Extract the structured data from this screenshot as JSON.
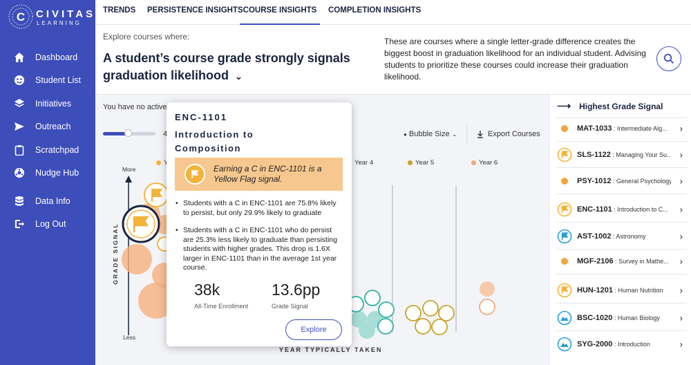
{
  "brand": {
    "line1": "CIVITAS",
    "line2": "LEARNING",
    "letter": "C"
  },
  "sidebar": {
    "items": [
      {
        "label": "Dashboard",
        "icon": "home-icon"
      },
      {
        "label": "Student List",
        "icon": "student-icon"
      },
      {
        "label": "Initiatives",
        "icon": "layers-icon"
      },
      {
        "label": "Outreach",
        "icon": "send-icon"
      },
      {
        "label": "Scratchpad",
        "icon": "clipboard-icon"
      },
      {
        "label": "Nudge Hub",
        "icon": "nudge-icon"
      },
      {
        "label": "Data Info",
        "icon": "database-icon"
      },
      {
        "label": "Log Out",
        "icon": "logout-icon"
      }
    ]
  },
  "tabs": [
    {
      "label": "TRENDS"
    },
    {
      "label": "PERSISTENCE INSIGHTS"
    },
    {
      "label": "COURSE INSIGHTS",
      "active": true
    },
    {
      "label": "COMPLETION INSIGHTS"
    }
  ],
  "header": {
    "explore_label": "Explore courses where:",
    "headline": "A student’s course grade strongly signals graduation likelihood",
    "description": "These are courses where a single letter-grade difference creates the biggest boost in graduation likelihood for an individual student. Advising students to prioritize these courses could increase their graduation likelihood."
  },
  "main": {
    "no_active": "You have no active",
    "slider_value": "4",
    "bubble_size": "Bubble Size",
    "export": "Export Courses"
  },
  "chart": {
    "y_more": "More",
    "y_less": "Less",
    "y_label": "GRADE SIGNAL",
    "x_label": "YEAR TYPICALLY TAKEN",
    "legend": [
      {
        "label": "Y",
        "color": "#f4b33a"
      },
      {
        "label": "Year 4",
        "color": "#2bb3a0"
      },
      {
        "label": "Year 5",
        "color": "#c9a227"
      },
      {
        "label": "Year 6",
        "color": "#f4a97a"
      }
    ]
  },
  "tooltip": {
    "code": "ENC-1101",
    "name": "Introduction to Composition",
    "banner": "Earning a C in ENC-1101 is a Yellow Flag signal.",
    "bullets": [
      "Students with a C in ENC-1101 are 75.8% likely to persist, but only 29.9% likely to graduate",
      "Students with a C in ENC-1101 who do persist are 25.3% less likely to graduate than persisting students with higher grades. This drop is 1.6X larger in ENC-1101 than in the average 1st year course."
    ],
    "stat1_value": "38k",
    "stat1_label": "All-Time Enrollment",
    "stat2_value": "13.6pp",
    "stat2_label": "Grade Signal",
    "explore_label": "Explore"
  },
  "right_panel": {
    "header": "Highest Grade Signal",
    "items": [
      {
        "code": "MAT-1033",
        "name": ": Intermediate Alg...",
        "icon": "dot",
        "color": "#f4a43a"
      },
      {
        "code": "SLS-1122",
        "name": ": Managing Your Su...",
        "icon": "flag",
        "color": "#f4b33a"
      },
      {
        "code": "PSY-1012",
        "name": ": General Psychology",
        "icon": "dot",
        "color": "#f4a43a"
      },
      {
        "code": "ENC-1101",
        "name": ": Introduction to C...",
        "icon": "flag",
        "color": "#f4b33a"
      },
      {
        "code": "AST-1002",
        "name": ": Astronomy",
        "icon": "flag",
        "color": "#2a9fd6"
      },
      {
        "code": "MGF-2106",
        "name": ": Survey in Mathe...",
        "icon": "dot",
        "color": "#f4a43a"
      },
      {
        "code": "HUN-1201",
        "name": ": Human Nutrition",
        "icon": "flag",
        "color": "#f4b33a"
      },
      {
        "code": "BSC-1020",
        "name": ": Human Biology",
        "icon": "mountain",
        "color": "#2a9fd6"
      },
      {
        "code": "SYG-2000",
        "name": ": Introduction",
        "icon": "mountain",
        "color": "#2a9fd6"
      }
    ]
  }
}
